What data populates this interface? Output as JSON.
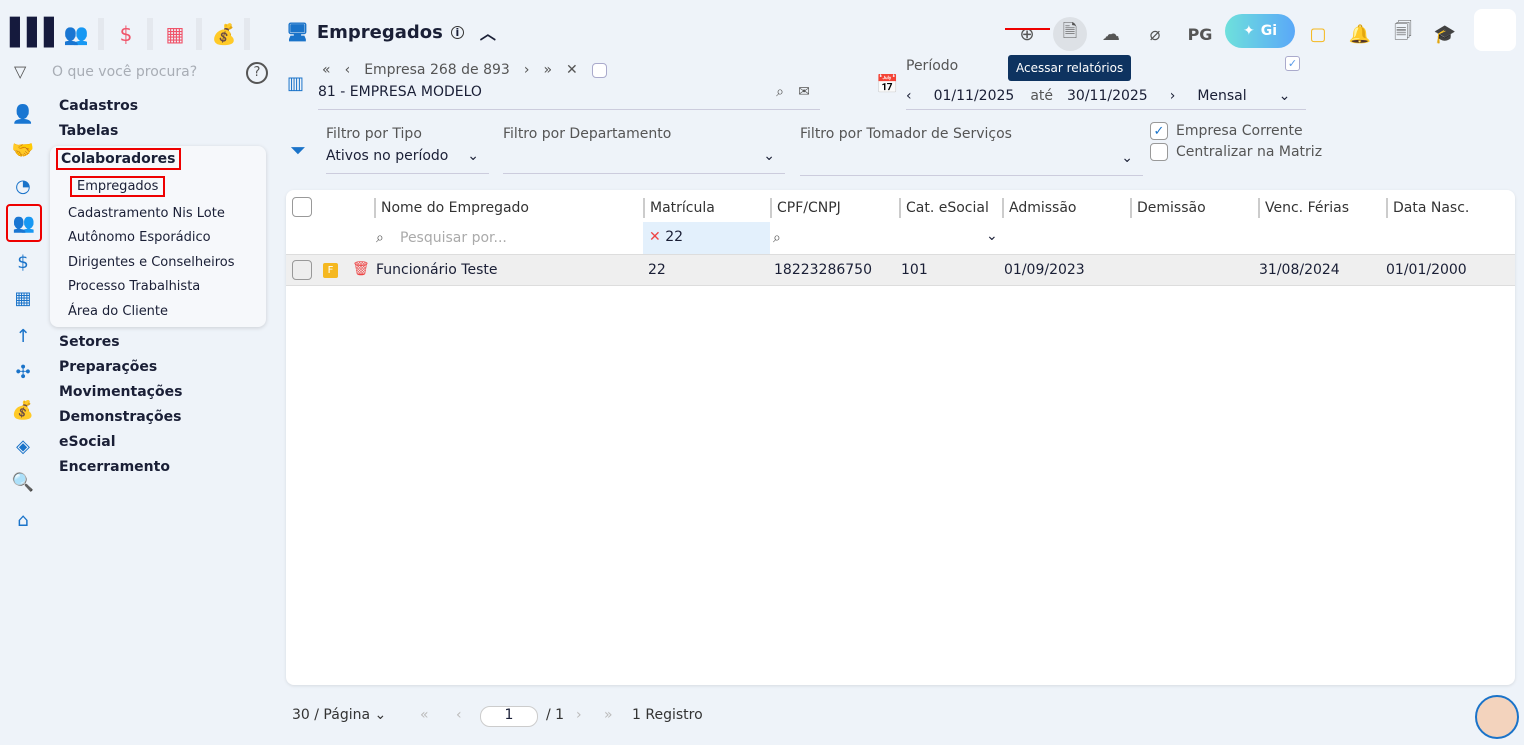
{
  "top_modules": [
    {
      "icon": "people-icon",
      "glyph": "👥"
    },
    {
      "icon": "dollar-icon",
      "glyph": "$"
    },
    {
      "icon": "calculator-icon",
      "glyph": "▦"
    },
    {
      "icon": "money-bag-icon",
      "glyph": "💰"
    }
  ],
  "search": {
    "placeholder": "O que você procura?",
    "help": "?"
  },
  "nav": {
    "items": [
      "Cadastros",
      "Tabelas",
      "Colaboradores",
      "Setores",
      "Preparações",
      "Movimentações",
      "Demonstrações",
      "eSocial",
      "Encerramento"
    ],
    "submenu": [
      "Empregados",
      "Cadastramento Nis Lote",
      "Autônomo Esporádico",
      "Dirigentes e Conselheiros",
      "Processo Trabalhista",
      "Área do Cliente"
    ]
  },
  "header": {
    "title": "Empregados",
    "tooltip": "Acessar relatórios",
    "pg": "PG",
    "gi": "Gi"
  },
  "company": {
    "nav_label": "Empresa",
    "current": "268",
    "of": "de",
    "total": "893",
    "name": "81 - EMPRESA MODELO"
  },
  "period": {
    "label": "Período",
    "start": "01/11/2025",
    "until": "até",
    "end": "30/11/2025",
    "mode": "Mensal"
  },
  "filters": {
    "tipo_label": "Filtro por Tipo",
    "tipo_value": "Ativos no período",
    "departamento_label": "Filtro por Departamento",
    "tomador_label": "Filtro por Tomador de Serviços",
    "empresa_corrente": "Empresa Corrente",
    "centralizar": "Centralizar na Matriz"
  },
  "table": {
    "columns": [
      "Nome do Empregado",
      "Matrícula",
      "CPF/CNPJ",
      "Cat. eSocial",
      "Admissão",
      "Demissão",
      "Venc. Férias",
      "Data Nasc."
    ],
    "search_placeholder": "Pesquisar por...",
    "matricula_filter": "22",
    "rows": [
      {
        "badge": "F",
        "nome": "Funcionário Teste",
        "matricula": "22",
        "cpf": "18223286750",
        "cat": "101",
        "admissao": "01/09/2023",
        "demissao": "",
        "ferias": "31/08/2024",
        "nasc": "01/01/2000"
      }
    ]
  },
  "pager": {
    "per_page": "30 / Página",
    "page": "1",
    "of": "/ 1",
    "count": "1 Registro"
  }
}
